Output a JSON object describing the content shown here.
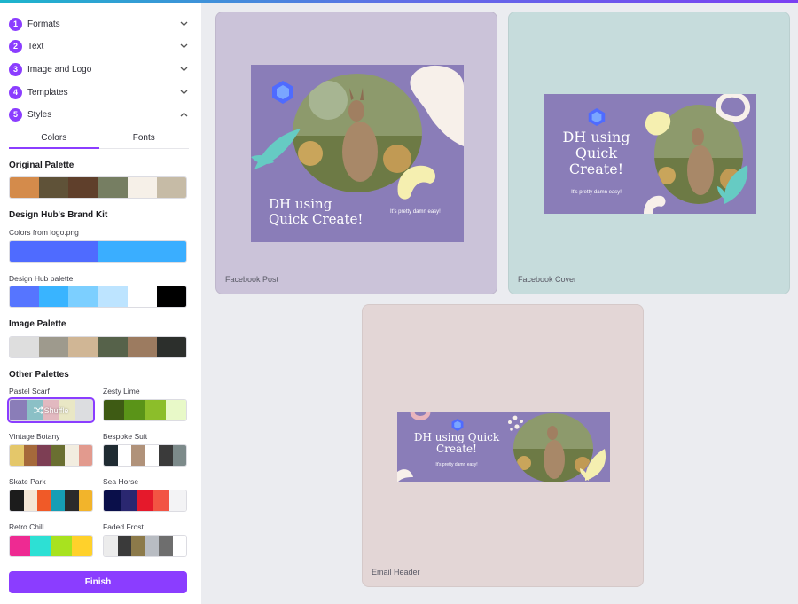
{
  "steps": [
    {
      "num": "1",
      "label": "Formats"
    },
    {
      "num": "2",
      "label": "Text"
    },
    {
      "num": "3",
      "label": "Image and Logo"
    },
    {
      "num": "4",
      "label": "Templates"
    },
    {
      "num": "5",
      "label": "Styles"
    }
  ],
  "tabs": {
    "colors": "Colors",
    "fonts": "Fonts"
  },
  "original_palette": {
    "title": "Original Palette",
    "colors": [
      "#d48b4b",
      "#5f5238",
      "#5f3f2b",
      "#767e62",
      "#f6f0e8",
      "#c6bba6"
    ]
  },
  "brand_kit": {
    "title": "Design Hub's Brand Kit",
    "logo_label": "Colors from logo.png",
    "logo_colors": [
      "#4f6bff",
      "#3aaeff"
    ],
    "hub_label": "Design Hub palette",
    "hub_colors": [
      "#5675ff",
      "#39b4ff",
      "#7ccfff",
      "#bde4ff",
      "#ffffff",
      "#000000"
    ]
  },
  "image_palette": {
    "title": "Image Palette",
    "colors": [
      "#dedede",
      "#9e9a8d",
      "#d0b695",
      "#56624a",
      "#9c7b60",
      "#2c2f2c"
    ]
  },
  "other_palettes": {
    "title": "Other Palettes",
    "items": [
      {
        "name": "Pastel Scarf",
        "colors": [
          "#8a7db8",
          "#8bc0c6",
          "#e2b9c0",
          "#e9e7c5",
          "#dcdde0"
        ],
        "selected": true,
        "overlay": "Shuffle"
      },
      {
        "name": "Zesty Lime",
        "colors": [
          "#3e5b14",
          "#5a9418",
          "#8cbe2a",
          "#e8f9c8"
        ],
        "selected": false,
        "overlay": ""
      },
      {
        "name": "Vintage Botany",
        "colors": [
          "#e4c76a",
          "#a5693b",
          "#7d3e54",
          "#6a6f31",
          "#f2ede0",
          "#e29a8e"
        ],
        "selected": false,
        "overlay": ""
      },
      {
        "name": "Bespoke Suit",
        "colors": [
          "#1f2b32",
          "#ffffff",
          "#b0927a",
          "#ffffff",
          "#3a3a3a",
          "#7c8a8a"
        ],
        "selected": false,
        "overlay": ""
      },
      {
        "name": "Skate Park",
        "colors": [
          "#1c1c1c",
          "#f4e7d6",
          "#f05a28",
          "#169eb4",
          "#2b2b2b",
          "#f2b42b"
        ],
        "selected": false,
        "overlay": ""
      },
      {
        "name": "Sea Horse",
        "colors": [
          "#0a0f4a",
          "#2a2770",
          "#e5192b",
          "#f25443",
          "#f3f3f5"
        ],
        "selected": false,
        "overlay": ""
      },
      {
        "name": "Retro Chill",
        "colors": [
          "#ee2a92",
          "#2de0d4",
          "#a8e21f",
          "#ffd12b"
        ],
        "selected": false,
        "overlay": ""
      },
      {
        "name": "Faded Frost",
        "colors": [
          "#ececec",
          "#3a3a3a",
          "#8c7a4a",
          "#b8bcc2",
          "#6e6e6e",
          "#ffffff"
        ],
        "selected": false,
        "overlay": ""
      }
    ]
  },
  "finish_label": "Finish",
  "designs": [
    {
      "name": "Facebook Post",
      "headline": "DH using Quick Create!",
      "tagline": "It's pretty damn easy!",
      "card_color": "#cbc3d9"
    },
    {
      "name": "Facebook Cover",
      "headline": "DH using Quick Create!",
      "tagline": "It's pretty damn easy!",
      "card_color": "#c6dcdc"
    },
    {
      "name": "Email Header",
      "headline": "DH using Quick Create!",
      "tagline": "It's pretty damn easy!",
      "card_color": "#e3d6d6"
    }
  ],
  "colors": {
    "accent": "#8b3dff",
    "design_bg": "#8a7db8",
    "shape_cream": "#f7f0ea",
    "shape_yellow": "#f5efb0",
    "shape_teal": "#66cbc3",
    "shape_pink": "#e9b5bd"
  },
  "icons": {
    "step_toggle_collapsed": "chevron-down-icon",
    "step_toggle_expanded": "chevron-up-icon",
    "shuffle": "shuffle-icon",
    "logo": "design-hub-logo-icon"
  }
}
